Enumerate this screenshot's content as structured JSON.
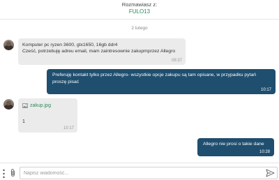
{
  "header": {
    "label": "Rozmawiasz z:",
    "contact_name": "FULO13"
  },
  "date_separator": "2 lutego",
  "messages": [
    {
      "direction": "incoming",
      "lines": [
        "Komputer pc ryzen 3600, gtx1650, 16gb ddr4",
        "Cześć, potrzebuję adreu email, mam zaintresownie zakupmprzez Allegro"
      ],
      "time": "08:37"
    },
    {
      "direction": "outgoing",
      "text": "Preferuję kontakt tylko przez Allegro- wszystkie opcje zakupu są tam opisane, w przypadku pytań proszę pisać",
      "time": "10:17"
    },
    {
      "direction": "incoming",
      "attachment_name": "zakup.jpg",
      "text": "1",
      "time": "10:17"
    },
    {
      "direction": "outgoing",
      "text": "Allegro nie prosi o takie dane",
      "time": "10:28"
    }
  ],
  "composer": {
    "placeholder": "Napisz wiadomość...",
    "value": ""
  },
  "icons": {
    "menu": "vertical-dots-icon",
    "attach": "paperclip-icon",
    "send": "send-icon",
    "attachment_file": "image-file-icon"
  },
  "colors": {
    "outgoing_bubble": "#1f4e6e",
    "incoming_bubble": "#ebebeb",
    "accent_link": "#2e8b57"
  }
}
